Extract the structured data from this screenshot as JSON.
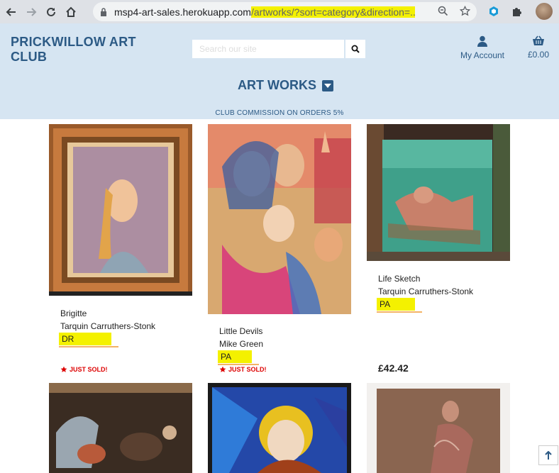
{
  "browser": {
    "url_host": "msp4-art-sales.herokuapp.com",
    "url_path": "/artworks/?sort=category&direction=..."
  },
  "header": {
    "brand": "PRICKWILLOW ART CLUB",
    "search_placeholder": "Search our site",
    "account_label": "My Account",
    "basket_total": "£0.00",
    "section_title": "ART WORKS",
    "commission_notice": "CLUB COMMISSION ON ORDERS 5%"
  },
  "products": [
    {
      "title": "Brigitte",
      "artist": "Tarquin Carruthers-Stonk",
      "category": "DR",
      "status": "JUST SOLD!",
      "price": ""
    },
    {
      "title": "Little Devils",
      "artist": "Mike Green",
      "category": "PA",
      "status": "JUST SOLD!",
      "price": ""
    },
    {
      "title": "Life Sketch",
      "artist": "Tarquin Carruthers-Stonk",
      "category": "PA",
      "status": "",
      "price": "£42.42"
    }
  ],
  "colors": {
    "header_bg": "#d6e5f2",
    "brand": "#2c5a85",
    "highlight": "#f4f100",
    "sold": "#dd0000"
  }
}
